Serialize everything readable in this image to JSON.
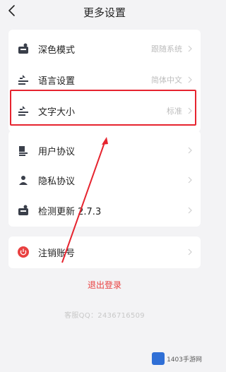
{
  "header": {
    "title": "更多设置",
    "back_icon": "chevron-left-icon"
  },
  "settings_group_1": [
    {
      "label": "深色模式",
      "value": "跟随系统",
      "icon": "dark-mode-icon"
    },
    {
      "label": "语言设置",
      "value": "简体中文",
      "icon": "language-icon"
    },
    {
      "label": "文字大小",
      "value": "标准",
      "icon": "text-size-icon"
    }
  ],
  "settings_group_2": [
    {
      "label": "用户协议",
      "icon": "user-agreement-icon"
    },
    {
      "label": "隐私协议",
      "icon": "privacy-icon"
    },
    {
      "label": "检测更新 2.7.3",
      "icon": "update-icon"
    }
  ],
  "settings_group_3": [
    {
      "label": "注销账号",
      "icon": "power-icon"
    }
  ],
  "logout_label": "退出登录",
  "version_text": "客服QQ：2436716509",
  "watermark": {
    "text": "1403手游网"
  },
  "colors": {
    "highlight": "#e6242f",
    "logout": "#e94040",
    "background": "#f3f3f5"
  }
}
